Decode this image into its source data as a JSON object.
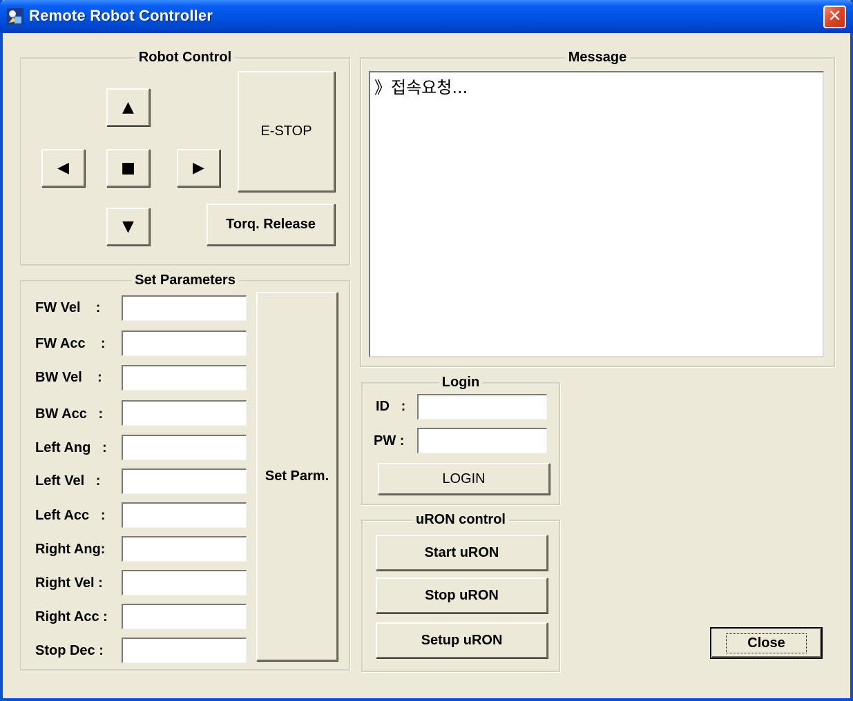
{
  "window": {
    "title": "Remote Robot Controller"
  },
  "robot_control": {
    "title": "Robot Control",
    "estop_label": "E-STOP",
    "torque_release_label": "Torq. Release"
  },
  "set_parameters": {
    "title": "Set Parameters",
    "button_label": "Set Parm.",
    "fields": [
      {
        "label": "FW Vel    :",
        "value": ""
      },
      {
        "label": "FW Acc    :",
        "value": ""
      },
      {
        "label": "BW Vel    :",
        "value": ""
      },
      {
        "label": "BW Acc   :",
        "value": ""
      },
      {
        "label": "Left Ang   :",
        "value": ""
      },
      {
        "label": "Left Vel   :",
        "value": ""
      },
      {
        "label": "Left Acc   :",
        "value": ""
      },
      {
        "label": "Right Ang:",
        "value": ""
      },
      {
        "label": "Right Vel :",
        "value": ""
      },
      {
        "label": "Right Acc :",
        "value": ""
      },
      {
        "label": "Stop Dec :",
        "value": ""
      }
    ]
  },
  "message": {
    "title": "Message",
    "text": "》접속요청..."
  },
  "login": {
    "title": "Login",
    "id_label": "ID   :",
    "pw_label": "PW :",
    "id_value": "",
    "pw_value": "",
    "button_label": "LOGIN"
  },
  "uron": {
    "title": "uRON control",
    "start_label": "Start uRON",
    "stop_label": "Stop uRON",
    "setup_label": "Setup uRON"
  },
  "footer": {
    "close_label": "Close"
  },
  "colors": {
    "titlebar": "#0054e3",
    "face": "#ece9d8",
    "close_x": "#d9452a"
  }
}
